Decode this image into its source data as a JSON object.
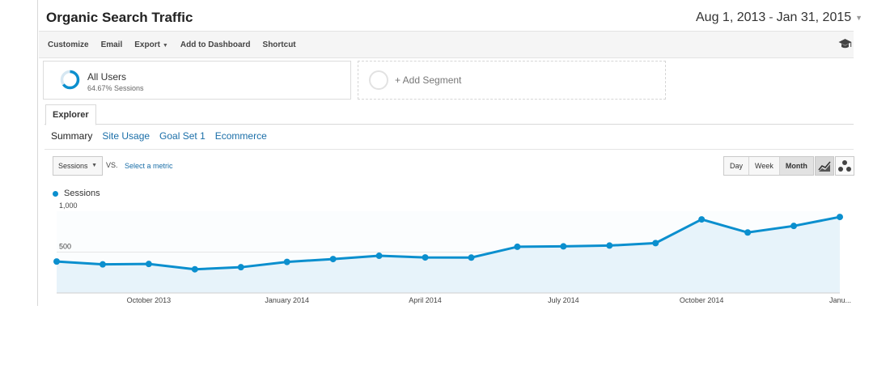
{
  "header": {
    "title": "Organic Search Traffic",
    "date_start": "Aug 1, 2013",
    "date_sep": "-",
    "date_end": "Jan 31, 2015"
  },
  "toolbar": {
    "customize": "Customize",
    "email": "Email",
    "export": "Export",
    "add_to_dashboard": "Add to Dashboard",
    "shortcut": "Shortcut"
  },
  "segments": {
    "all_users": {
      "title": "All Users",
      "subtitle": "64.67% Sessions"
    },
    "add_segment": "+ Add Segment"
  },
  "tabs": {
    "explorer": "Explorer"
  },
  "subnav": [
    "Summary",
    "Site Usage",
    "Goal Set 1",
    "Ecommerce"
  ],
  "controls": {
    "metric": "Sessions",
    "vs": "VS.",
    "select_metric": "Select a metric",
    "periods": [
      "Day",
      "Week",
      "Month"
    ],
    "active_period": "Month"
  },
  "colors": {
    "series": "#0b8fce",
    "area": "#e7f3fa",
    "link": "#1a6ea8"
  },
  "chart_data": {
    "type": "area",
    "series": [
      {
        "name": "Sessions",
        "values": [
          385,
          350,
          355,
          290,
          315,
          380,
          415,
          455,
          435,
          433,
          565,
          570,
          580,
          610,
          900,
          740,
          820,
          930
        ]
      }
    ],
    "x": [
      "Aug 2013",
      "Sep 2013",
      "Oct 2013",
      "Nov 2013",
      "Dec 2013",
      "Jan 2014",
      "Feb 2014",
      "Mar 2014",
      "Apr 2014",
      "May 2014",
      "Jun 2014",
      "Jul 2014",
      "Aug 2014",
      "Sep 2014",
      "Oct 2014",
      "Nov 2014",
      "Dec 2014",
      "Jan 2015"
    ],
    "xtick_labels": [
      "October 2013",
      "January 2014",
      "April 2014",
      "July 2014",
      "October 2014",
      "Janu..."
    ],
    "xtick_index": [
      2,
      5,
      8,
      11,
      14,
      17
    ],
    "ytick_labels": [
      "1,000",
      "500"
    ],
    "ytick_values": [
      1000,
      500
    ],
    "ylim": [
      0,
      1000
    ],
    "grid": true
  }
}
